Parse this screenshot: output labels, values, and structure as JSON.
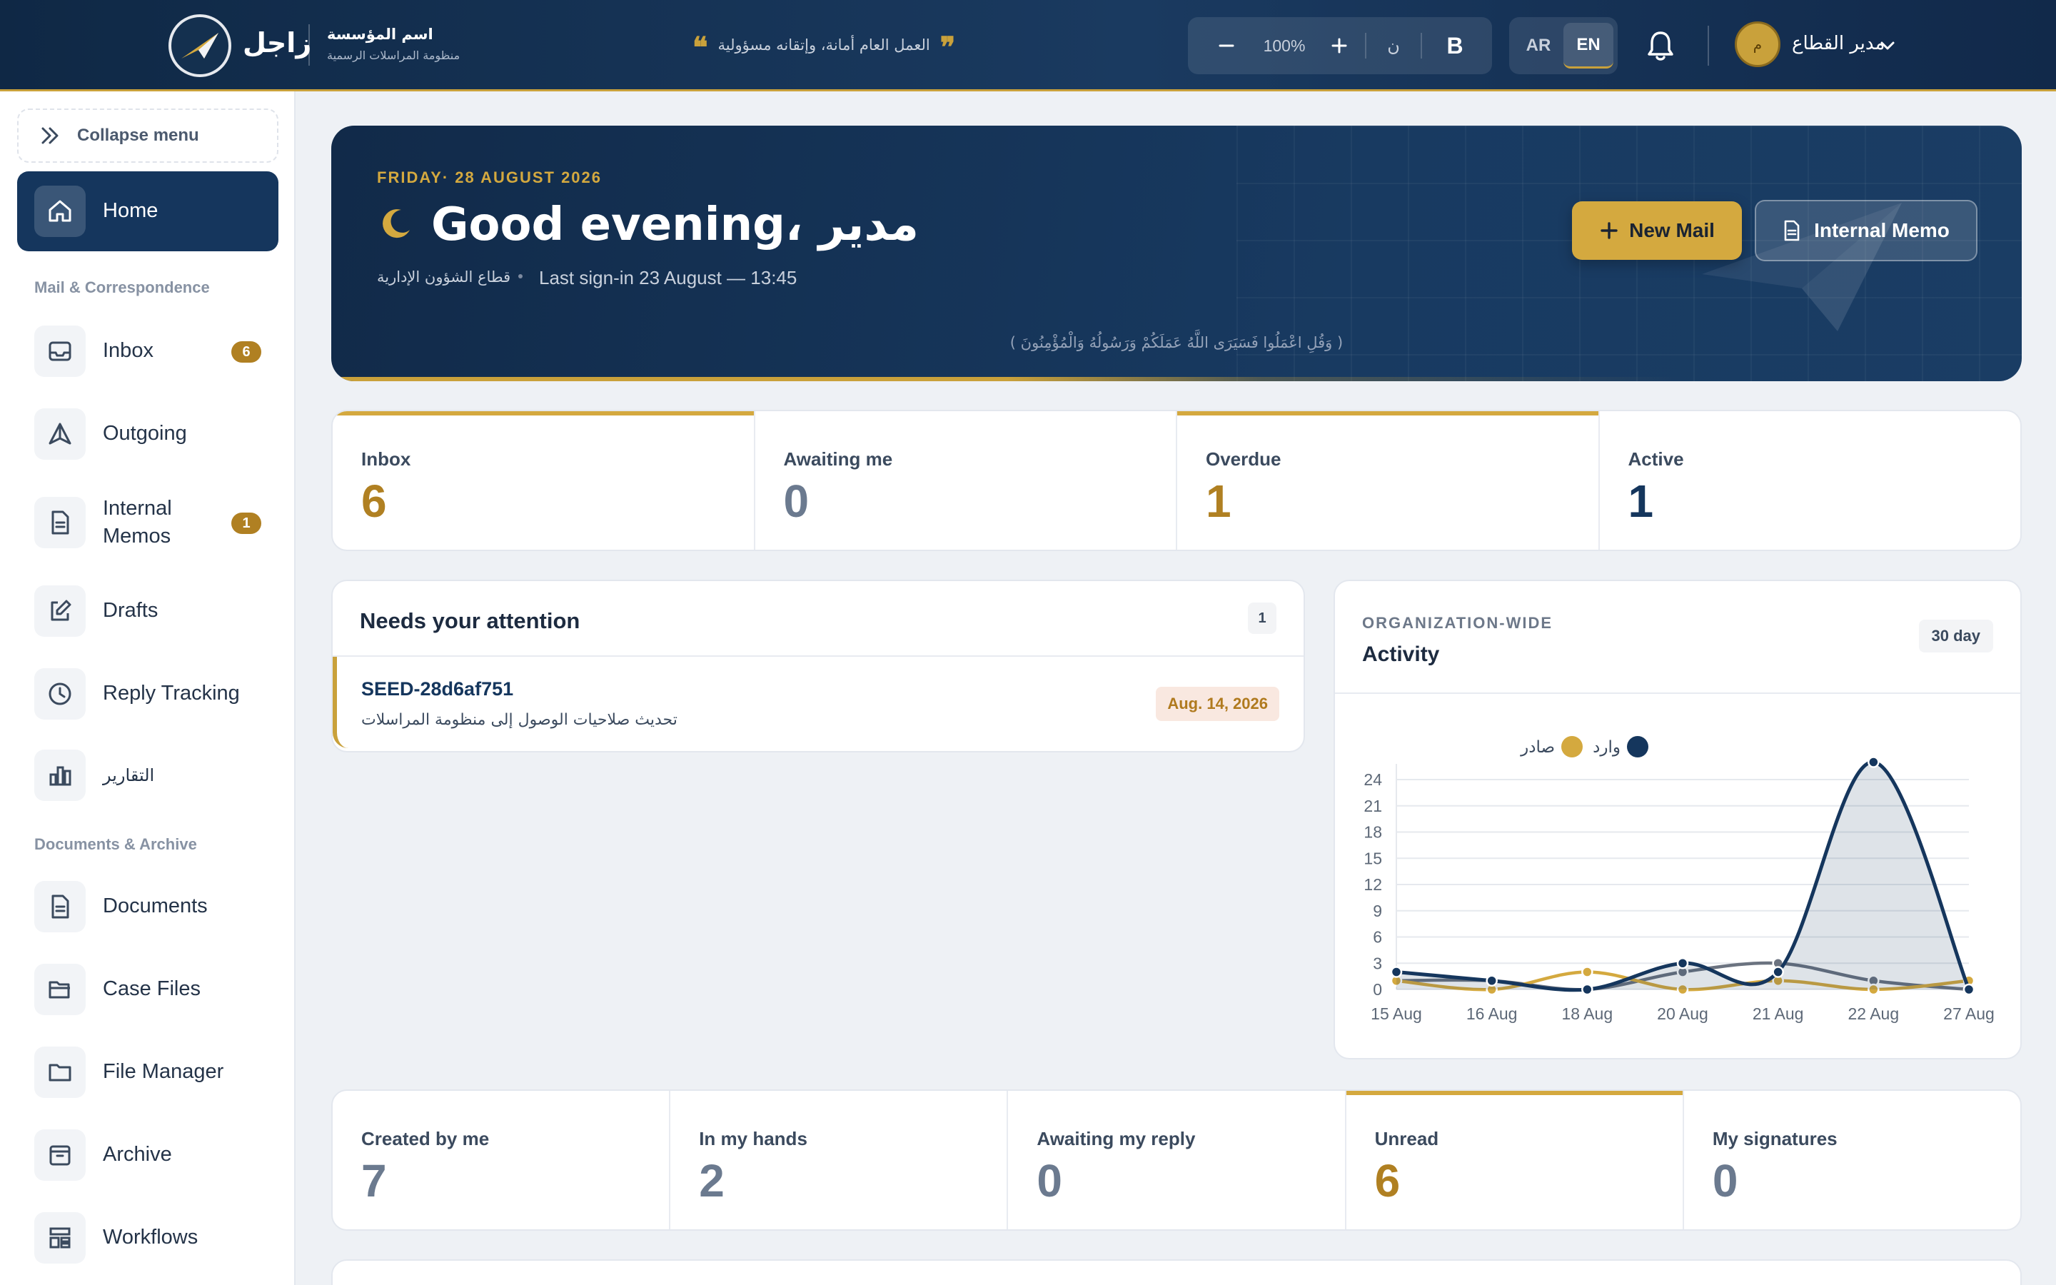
{
  "topbar": {
    "app_name": "زاجل",
    "org_name": "اسم المؤسسة",
    "org_subtitle": "منظومة المراسلات الرسمية",
    "motto": "العمل العام أمانة، وإتقانه مسؤولية",
    "zoom": "100%",
    "font_toggle": "ن",
    "bold_toggle": "B",
    "lang_ar": "AR",
    "lang_en": "EN",
    "active_lang": "EN",
    "user_name": "مدير القطاع",
    "user_initial": "م"
  },
  "sidebar": {
    "collapse_label": "Collapse menu",
    "home_label": "Home",
    "section_mail": "Mail & Correspondence",
    "section_docs": "Documents & Archive",
    "items": [
      {
        "label": "Inbox",
        "badge": "6",
        "icon": "inbox-icon"
      },
      {
        "label": "Outgoing",
        "icon": "send-icon"
      },
      {
        "label": "Internal Memos",
        "badge": "1",
        "icon": "memo-icon"
      },
      {
        "label": "Drafts",
        "icon": "edit-icon"
      },
      {
        "label": "Reply Tracking",
        "icon": "clock-icon"
      },
      {
        "label": "التقارير",
        "icon": "bar-chart-icon"
      },
      {
        "label": "Documents",
        "icon": "document-icon"
      },
      {
        "label": "Case Files",
        "icon": "folder-open-icon"
      },
      {
        "label": "File Manager",
        "icon": "folder-icon"
      },
      {
        "label": "Archive",
        "icon": "archive-icon"
      },
      {
        "label": "Workflows",
        "icon": "workflow-icon"
      }
    ]
  },
  "hero": {
    "date": "FRIDAY· 28 AUGUST 2026",
    "greeting": "Good evening، مدير",
    "department": "قطاع الشؤون الإدارية",
    "last_signin": "Last sign-in 23 August — 13:45",
    "verse": "( وَقُلِ اعْمَلُوا فَسَيَرَى اللَّهُ عَمَلَكُمْ وَرَسُولُهُ وَالْمُؤْمِنُونَ )",
    "new_mail_label": "New Mail",
    "internal_memo_label": "Internal Memo"
  },
  "stats_top": [
    {
      "label": "Inbox",
      "value": "6",
      "color": "#b08022",
      "accent": true
    },
    {
      "label": "Awaiting me",
      "value": "0",
      "color": "#6b7a8f",
      "accent": false
    },
    {
      "label": "Overdue",
      "value": "1",
      "color": "#b08022",
      "accent": true
    },
    {
      "label": "Active",
      "value": "1",
      "color": "#15365d",
      "accent": false
    }
  ],
  "attention": {
    "title": "Needs your attention",
    "count": "1",
    "items": [
      {
        "id": "SEED-28d6af751",
        "subject": "تحديث صلاحيات الوصول إلى منظومة المراسلات",
        "date": "Aug. 14, 2026"
      }
    ]
  },
  "activity": {
    "kicker": "ORGANIZATION-WIDE",
    "title": "Activity",
    "range": "30 day"
  },
  "chart_data": {
    "type": "line",
    "x": [
      "15 Aug",
      "16 Aug",
      "18 Aug",
      "20 Aug",
      "21 Aug",
      "22 Aug",
      "27 Aug"
    ],
    "ylim": [
      0,
      24
    ],
    "yticks": [
      0,
      3,
      6,
      9,
      12,
      15,
      18,
      21,
      24
    ],
    "legend_position": "top",
    "series": [
      {
        "name": "وارد",
        "color": "#15365d",
        "values": [
          2,
          1,
          0,
          3,
          2,
          26,
          0
        ]
      },
      {
        "name": "صادر",
        "color": "#d4a93f",
        "values": [
          1,
          0,
          2,
          0,
          1,
          0,
          1
        ]
      },
      {
        "color": "#6b7380",
        "values": [
          1,
          1,
          0,
          2,
          3,
          1,
          0
        ]
      }
    ]
  },
  "stats_bottom": [
    {
      "label": "Created by me",
      "value": "7",
      "color": "#6b7a8f",
      "accent": false
    },
    {
      "label": "In my hands",
      "value": "2",
      "color": "#6b7a8f",
      "accent": false
    },
    {
      "label": "Awaiting my reply",
      "value": "0",
      "color": "#6b7a8f",
      "accent": false
    },
    {
      "label": "Unread",
      "value": "6",
      "color": "#b08022",
      "accent": true
    },
    {
      "label": "My signatures",
      "value": "0",
      "color": "#6b7a8f",
      "accent": false
    }
  ]
}
